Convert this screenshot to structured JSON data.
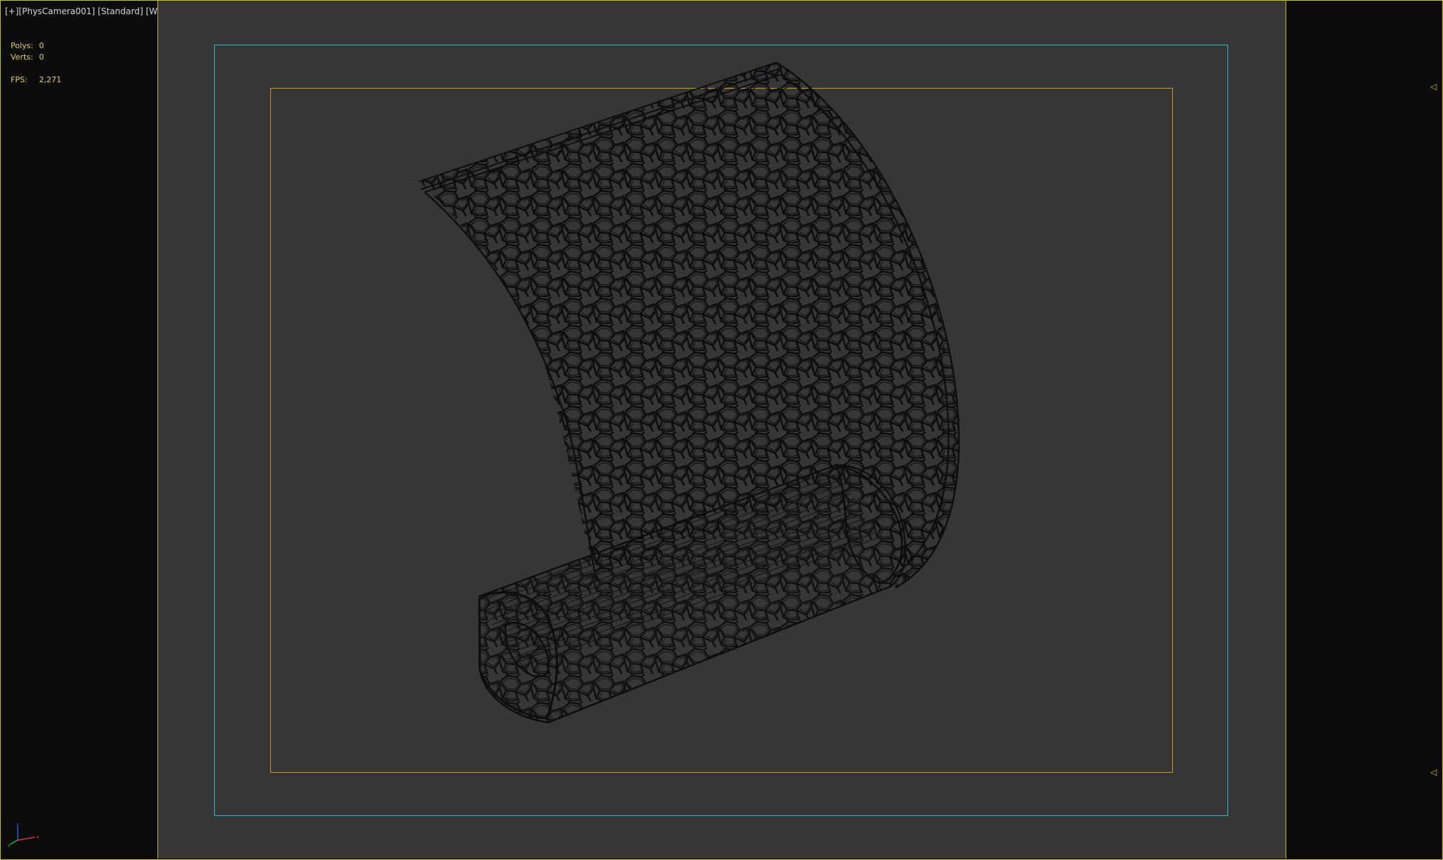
{
  "viewport": {
    "label_plus": "[+]",
    "label_camera": "[PhysCamera001]",
    "label_shading": "[Standard]",
    "label_mode": "[Wireframe]"
  },
  "stats": {
    "polys_label": "Polys:",
    "polys_value": "0",
    "verts_label": "Verts:",
    "verts_value": "0",
    "fps_label": "FPS:",
    "fps_value": "2,271"
  },
  "colors": {
    "viewport_border": "#c8c21a",
    "safe_frame_outer": "#2fb9c9",
    "safe_frame_inner": "#c69a2b",
    "stats_text": "#e2d063",
    "wire": "#0e0e0e",
    "background": "#363636"
  },
  "icons": {
    "axis": "axis-tripod-icon",
    "marker": "triangle-left-icon"
  }
}
